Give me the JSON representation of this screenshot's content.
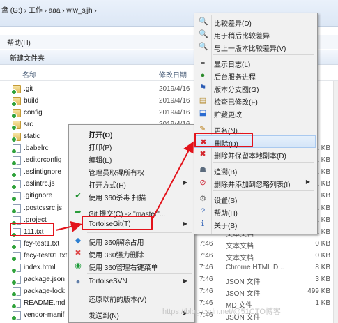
{
  "window": {
    "breadcrumb": "盘 (G:)  ›  工作  ›  aaa  ›  wlw_sjjh  ›",
    "menu_help": "帮助(H)",
    "toolbar_new_folder": "新建文件夹",
    "columns": {
      "name": "名称",
      "date": "修改日期"
    }
  },
  "files": [
    {
      "name": ".git",
      "date": "2019/4/16",
      "time": "",
      "type": "",
      "size": "",
      "kind": "folder"
    },
    {
      "name": "build",
      "date": "2019/4/16",
      "time": "",
      "type": "",
      "size": "",
      "kind": "folder"
    },
    {
      "name": "config",
      "date": "2019/4/16",
      "time": "",
      "type": "",
      "size": "",
      "kind": "folder"
    },
    {
      "name": "src",
      "date": "2019/4/16",
      "time": "",
      "type": "",
      "size": "",
      "kind": "folder"
    },
    {
      "name": "static",
      "date": "",
      "time": "",
      "type": "",
      "size": "",
      "kind": "folder"
    },
    {
      "name": ".babelrc",
      "date": "",
      "time": "",
      "type": "",
      "size": "1 KB",
      "kind": "file"
    },
    {
      "name": ".editorconfig",
      "date": "",
      "time": "",
      "type": "",
      "size": "1 KB",
      "kind": "file"
    },
    {
      "name": ".eslintignore",
      "date": "",
      "time": "",
      "type": "",
      "size": "1 KB",
      "kind": "file"
    },
    {
      "name": ".eslintrc.js",
      "date": "",
      "time": "",
      "type": "",
      "size": "1 KB",
      "kind": "file"
    },
    {
      "name": ".gitignore",
      "date": "",
      "time": "",
      "type": "",
      "size": "1 KB",
      "kind": "file"
    },
    {
      "name": ".postcssrc.js",
      "date": "",
      "time": "",
      "type": "",
      "size": "1 KB",
      "kind": "file"
    },
    {
      "name": ".project",
      "date": "",
      "time": "",
      "type": "",
      "size": "1 KB",
      "kind": "file"
    },
    {
      "name": "111.txt",
      "date": "",
      "time": "",
      "type": "文本文档",
      "size": "1 KB",
      "kind": "file"
    },
    {
      "name": "fcy-test1.txt",
      "date": "",
      "time": "7:46",
      "type": "文本文档",
      "size": "0 KB",
      "kind": "file"
    },
    {
      "name": "fecy-test01.txt",
      "date": "",
      "time": "7:46",
      "type": "文本文档",
      "size": "0 KB",
      "kind": "file"
    },
    {
      "name": "index.html",
      "date": "",
      "time": "7:46",
      "type": "Chrome HTML D...",
      "size": "8 KB",
      "kind": "file"
    },
    {
      "name": "package.json",
      "date": "",
      "time": "7:46",
      "type": "JSON 文件",
      "size": "3 KB",
      "kind": "file"
    },
    {
      "name": "package-lock",
      "date": "",
      "time": "7:46",
      "type": "JSON 文件",
      "size": "499 KB",
      "kind": "file"
    },
    {
      "name": "README.md",
      "date": "",
      "time": "7:46",
      "type": "MD 文件",
      "size": "1 KB",
      "kind": "file"
    },
    {
      "name": "vendor-manif",
      "date": "",
      "time": "7:46",
      "type": "JSON 文件",
      "size": "",
      "kind": "file"
    }
  ],
  "context_menu": {
    "items": [
      {
        "label": "打开(O)",
        "bold": true,
        "icon": ""
      },
      {
        "label": "打印(P)",
        "icon": ""
      },
      {
        "label": "编辑(E)",
        "icon": ""
      },
      {
        "label": "管理员取得所有权",
        "icon": ""
      },
      {
        "label": "打开方式(H)",
        "icon": "",
        "submenu": true
      },
      {
        "label": "使用 360杀毒 扫描",
        "icon": "shield-icon"
      },
      {
        "label": "Git 提交(C) -> \"master\"...",
        "icon": "git-commit-icon"
      },
      {
        "label": "TortoiseGit(T)",
        "icon": "tortoisegit-icon",
        "submenu": true
      },
      {
        "label": "使用 360解除占用",
        "icon": "unlock-icon"
      },
      {
        "label": "使用 360强力删除",
        "icon": "shred-icon"
      },
      {
        "label": "使用 360管理右键菜单",
        "icon": "menu-manager-icon"
      },
      {
        "label": "TortoiseSVN",
        "icon": "tortoisesvn-icon",
        "submenu": true
      },
      {
        "label": "还原以前的版本(V)",
        "icon": ""
      },
      {
        "label": "发送到(N)",
        "icon": "",
        "submenu": true
      }
    ]
  },
  "tortoisegit_menu": {
    "items": [
      {
        "label": "比较差异(D)",
        "icon": "diff-icon"
      },
      {
        "label": "用于稍后比较差异",
        "icon": "diff-later-icon"
      },
      {
        "label": "与上一版本比较差异(V)",
        "icon": "diff-prev-icon"
      },
      {
        "label": "显示日志(L)",
        "icon": "log-icon"
      },
      {
        "label": "后台服务进程",
        "icon": "daemon-icon"
      },
      {
        "label": "版本分支图(G)",
        "icon": "branch-graph-icon"
      },
      {
        "label": "检查已修改(F)",
        "icon": "check-modified-icon"
      },
      {
        "label": "贮藏更改",
        "icon": "stash-icon"
      },
      {
        "label": "更名(N)...",
        "icon": "rename-icon"
      },
      {
        "label": "删除(D)",
        "icon": "delete-icon",
        "highlighted": true
      },
      {
        "label": "删除并保留本地副本(D)",
        "icon": "delete-keep-icon"
      },
      {
        "label": "追溯(B)",
        "icon": "blame-icon"
      },
      {
        "label": "删除并添加到忽略列表(I)",
        "icon": "ignore-icon",
        "submenu": true
      },
      {
        "label": "设置(S)",
        "icon": "settings-icon"
      },
      {
        "label": "帮助(H)",
        "icon": "help-icon"
      },
      {
        "label": "关于(B)",
        "icon": "about-icon"
      }
    ]
  },
  "watermark": "https://blog.csdn.net/@51CTO博客",
  "colors": {
    "highlight_red": "#e3131b",
    "menu_bg": "#f1f1f1"
  }
}
